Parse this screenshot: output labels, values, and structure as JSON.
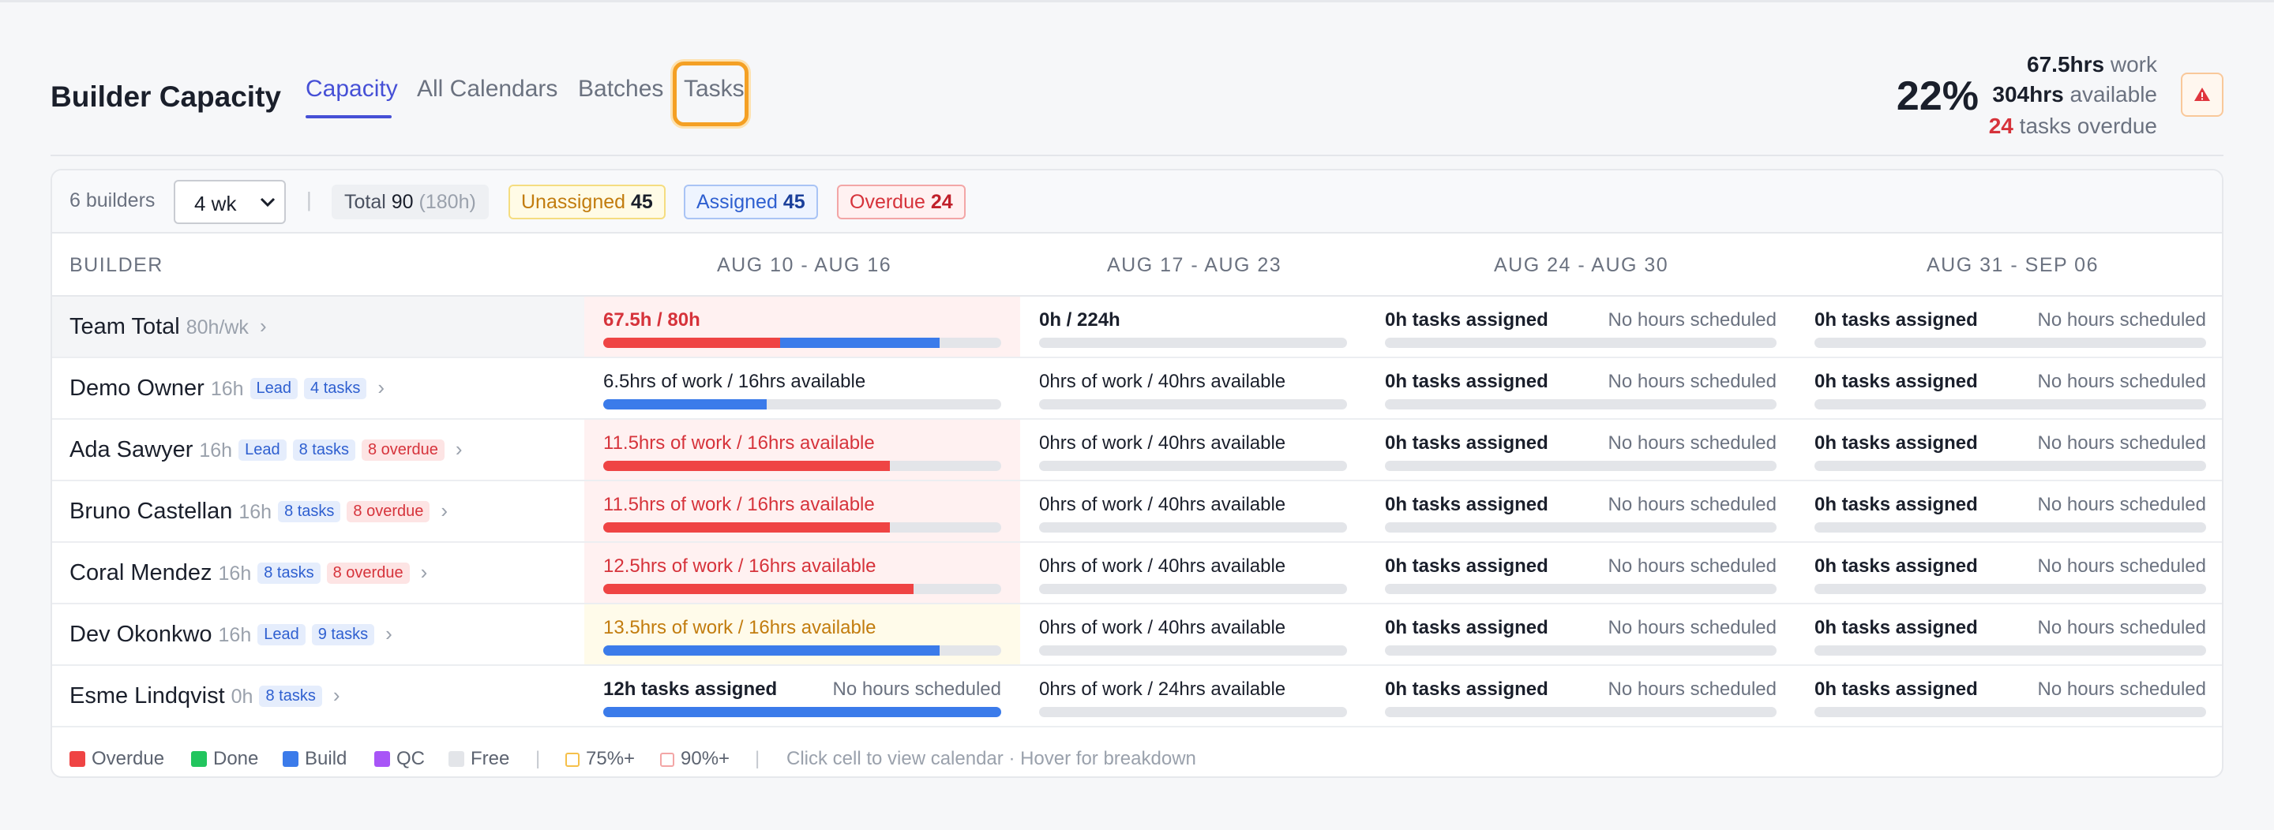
{
  "header": {
    "title": "Builder Capacity",
    "tabs": [
      {
        "label": "Capacity",
        "active": true
      },
      {
        "label": "All Calendars",
        "active": false
      },
      {
        "label": "Batches",
        "active": false
      },
      {
        "label": "Tasks",
        "active": false,
        "focused": true
      }
    ],
    "stats": {
      "utilization": "22%",
      "work_value": "67.5hrs",
      "work_label": "work",
      "available_value": "304hrs",
      "available_label": "available",
      "overdue_value": "24",
      "overdue_label": "tasks overdue"
    },
    "alert_icon": "warning-triangle-icon"
  },
  "toolbar": {
    "builder_count": "6 builders",
    "range_select": "4 wk",
    "separator": "|",
    "total_label": "Total",
    "total_value": "90",
    "total_hours": "(180h)",
    "unassigned_label": "Unassigned",
    "unassigned_value": "45",
    "assigned_label": "Assigned",
    "assigned_value": "45",
    "overdue_label": "Overdue",
    "overdue_value": "24"
  },
  "columns": {
    "builder": "BUILDER",
    "weeks": [
      "AUG 10 - AUG 16",
      "AUG 17 - AUG 23",
      "AUG 24 - AUG 30",
      "AUG 31 - SEP 06"
    ]
  },
  "rows": [
    {
      "name": "Team Total",
      "meta": "80h/wk",
      "tags": [],
      "weeks": [
        {
          "label": "67.5h / 80h",
          "right": "",
          "style": "red",
          "bg": "red",
          "segments": [
            {
              "c": "red",
              "f": 0.445
            },
            {
              "c": "blue",
              "f": 0.4
            }
          ]
        },
        {
          "label": "0h / 224h",
          "right": "",
          "style": "bold",
          "bg": "",
          "segments": []
        },
        {
          "label": "0h tasks assigned",
          "right": "No hours scheduled",
          "style": "bold",
          "bg": "",
          "segments": []
        },
        {
          "label": "0h tasks assigned",
          "right": "No hours scheduled",
          "style": "bold",
          "bg": "",
          "segments": []
        }
      ]
    },
    {
      "name": "Demo Owner",
      "meta": "16h",
      "tags": [
        {
          "text": "Lead",
          "kind": "lead"
        },
        {
          "text": "4 tasks",
          "kind": "tasks"
        }
      ],
      "weeks": [
        {
          "label": "6.5hrs of work / 16hrs available",
          "right": "",
          "style": "normal",
          "bg": "",
          "segments": [
            {
              "c": "blue",
              "f": 0.41
            }
          ]
        },
        {
          "label": "0hrs of work / 40hrs available",
          "right": "",
          "style": "normal",
          "bg": "",
          "segments": []
        },
        {
          "label": "0h tasks assigned",
          "right": "No hours scheduled",
          "style": "normal",
          "bg": "",
          "segments": []
        },
        {
          "label": "0h tasks assigned",
          "right": "No hours scheduled",
          "style": "normal",
          "bg": "",
          "segments": []
        }
      ]
    },
    {
      "name": "Ada Sawyer",
      "meta": "16h",
      "tags": [
        {
          "text": "Lead",
          "kind": "lead"
        },
        {
          "text": "8 tasks",
          "kind": "tasks"
        },
        {
          "text": "8 overdue",
          "kind": "over"
        }
      ],
      "weeks": [
        {
          "label": "11.5hrs of work / 16hrs available",
          "right": "",
          "style": "red",
          "bg": "red",
          "segments": [
            {
              "c": "red",
              "f": 0.72
            }
          ]
        },
        {
          "label": "0hrs of work / 40hrs available",
          "right": "",
          "style": "normal",
          "bg": "",
          "segments": []
        },
        {
          "label": "0h tasks assigned",
          "right": "No hours scheduled",
          "style": "normal",
          "bg": "",
          "segments": []
        },
        {
          "label": "0h tasks assigned",
          "right": "No hours scheduled",
          "style": "normal",
          "bg": "",
          "segments": []
        }
      ]
    },
    {
      "name": "Bruno Castellan",
      "meta": "16h",
      "tags": [
        {
          "text": "8 tasks",
          "kind": "tasks"
        },
        {
          "text": "8 overdue",
          "kind": "over"
        }
      ],
      "weeks": [
        {
          "label": "11.5hrs of work / 16hrs available",
          "right": "",
          "style": "red",
          "bg": "red",
          "segments": [
            {
              "c": "red",
              "f": 0.72
            }
          ]
        },
        {
          "label": "0hrs of work / 40hrs available",
          "right": "",
          "style": "normal",
          "bg": "",
          "segments": []
        },
        {
          "label": "0h tasks assigned",
          "right": "No hours scheduled",
          "style": "normal",
          "bg": "",
          "segments": []
        },
        {
          "label": "0h tasks assigned",
          "right": "No hours scheduled",
          "style": "normal",
          "bg": "",
          "segments": []
        }
      ]
    },
    {
      "name": "Coral Mendez",
      "meta": "16h",
      "tags": [
        {
          "text": "8 tasks",
          "kind": "tasks"
        },
        {
          "text": "8 overdue",
          "kind": "over"
        }
      ],
      "weeks": [
        {
          "label": "12.5hrs of work / 16hrs available",
          "right": "",
          "style": "red",
          "bg": "red",
          "segments": [
            {
              "c": "red",
              "f": 0.78
            }
          ]
        },
        {
          "label": "0hrs of work / 40hrs available",
          "right": "",
          "style": "normal",
          "bg": "",
          "segments": []
        },
        {
          "label": "0h tasks assigned",
          "right": "No hours scheduled",
          "style": "normal",
          "bg": "",
          "segments": []
        },
        {
          "label": "0h tasks assigned",
          "right": "No hours scheduled",
          "style": "normal",
          "bg": "",
          "segments": []
        }
      ]
    },
    {
      "name": "Dev Okonkwo",
      "meta": "16h",
      "tags": [
        {
          "text": "Lead",
          "kind": "lead"
        },
        {
          "text": "9 tasks",
          "kind": "tasks"
        }
      ],
      "weeks": [
        {
          "label": "13.5hrs of work / 16hrs available",
          "right": "",
          "style": "amber",
          "bg": "yellow",
          "segments": [
            {
              "c": "blue",
              "f": 0.845
            }
          ]
        },
        {
          "label": "0hrs of work / 40hrs available",
          "right": "",
          "style": "normal",
          "bg": "",
          "segments": []
        },
        {
          "label": "0h tasks assigned",
          "right": "No hours scheduled",
          "style": "normal",
          "bg": "",
          "segments": []
        },
        {
          "label": "0h tasks assigned",
          "right": "No hours scheduled",
          "style": "normal",
          "bg": "",
          "segments": []
        }
      ]
    },
    {
      "name": "Esme Lindqvist",
      "meta": "0h",
      "tags": [
        {
          "text": "8 tasks",
          "kind": "tasks"
        }
      ],
      "weeks": [
        {
          "label": "12h tasks assigned",
          "right": "No hours scheduled",
          "style": "normal",
          "bg": "",
          "segments": [
            {
              "c": "blue",
              "f": 1.0
            }
          ]
        },
        {
          "label": "0hrs of work / 24hrs available",
          "right": "",
          "style": "normal",
          "bg": "",
          "segments": []
        },
        {
          "label": "0h tasks assigned",
          "right": "No hours scheduled",
          "style": "normal",
          "bg": "",
          "segments": []
        },
        {
          "label": "0h tasks assigned",
          "right": "No hours scheduled",
          "style": "normal",
          "bg": "",
          "segments": []
        }
      ]
    }
  ],
  "legend": {
    "items": [
      {
        "label": "Overdue",
        "color": "#ef4444"
      },
      {
        "label": "Done",
        "color": "#22c55e"
      },
      {
        "label": "Build",
        "color": "#3b7bea"
      },
      {
        "label": "QC",
        "color": "#a855f7"
      },
      {
        "label": "Free",
        "color": "#e3e5e9"
      }
    ],
    "separator": "|",
    "thresholds": [
      {
        "label": "75%+",
        "color": "#f5c04a"
      },
      {
        "label": "90%+",
        "color": "#f3a6a6"
      }
    ],
    "hint": "Click cell to view calendar · Hover for breakdown"
  }
}
